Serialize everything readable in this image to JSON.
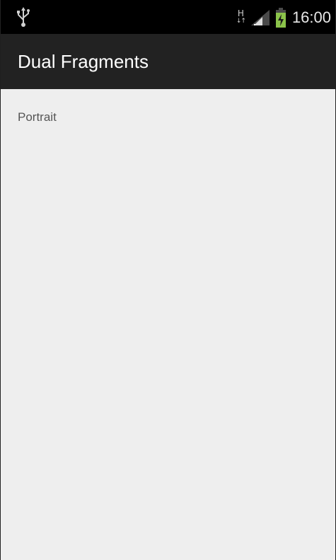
{
  "status_bar": {
    "usb_icon": "usb-icon",
    "network_type": "H",
    "signal_icon": "signal-icon",
    "battery_icon": "battery-charging-icon",
    "time": "16:00",
    "colors": {
      "background": "#000000",
      "battery": "#8bc34a"
    }
  },
  "action_bar": {
    "title": "Dual Fragments",
    "background": "#222222"
  },
  "content": {
    "label": "Portrait",
    "background": "#eeeeee"
  }
}
